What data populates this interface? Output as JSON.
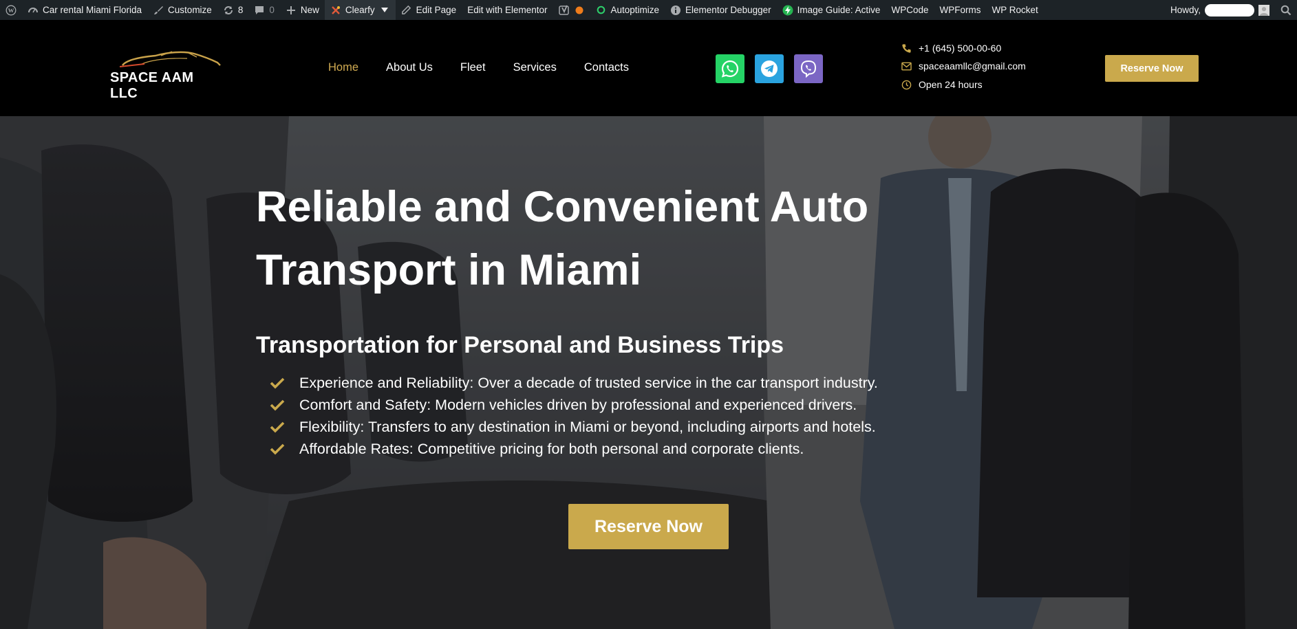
{
  "adminbar": {
    "site_name": "Car rental Miami Florida",
    "customize": "Customize",
    "updates_count": "8",
    "comments_count": "0",
    "new_label": "New",
    "clearfy": "Clearfy",
    "edit_page": "Edit Page",
    "edit_elementor": "Edit with Elementor",
    "autoptimize": "Autoptimize",
    "elementor_debugger": "Elementor Debugger",
    "image_guide": "Image Guide: Active",
    "wpcode": "WPCode",
    "wpforms": "WPForms",
    "wprocket": "WP Rocket",
    "howdy": "Howdy,"
  },
  "header": {
    "logo_text": "SPACE AAM LLC",
    "nav": [
      {
        "label": "Home",
        "current": true
      },
      {
        "label": "About Us"
      },
      {
        "label": "Fleet"
      },
      {
        "label": "Services"
      },
      {
        "label": "Contacts"
      }
    ],
    "social": [
      {
        "icon": "whatsapp-icon",
        "color": "#25d366"
      },
      {
        "icon": "telegram-icon",
        "color": "#2aa3df"
      },
      {
        "icon": "viber-icon",
        "color": "#7b66c4"
      }
    ],
    "phone": "+1 (645) 500-00-60",
    "email": "spaceaamllc@gmail.com",
    "hours": "Open 24 hours",
    "reserve_label": "Reserve Now"
  },
  "hero": {
    "title": "Reliable and Convenient Auto Transport in Miami",
    "subtitle": "Transportation for Personal and Business Trips",
    "features": [
      "Experience and Reliability: Over a decade of trusted service in the car transport industry.",
      "Comfort and Safety: Modern vehicles driven by professional and experienced drivers.",
      "Flexibility: Transfers to any destination in Miami or beyond, including airports and hotels.",
      "Affordable Rates: Competitive pricing for both personal and corporate clients."
    ],
    "reserve_label": "Reserve Now"
  },
  "colors": {
    "accent_gold": "#caa94c",
    "nav_active": "#d1ab52",
    "adminbar_bg": "#1d2327",
    "header_bg": "#000000"
  }
}
